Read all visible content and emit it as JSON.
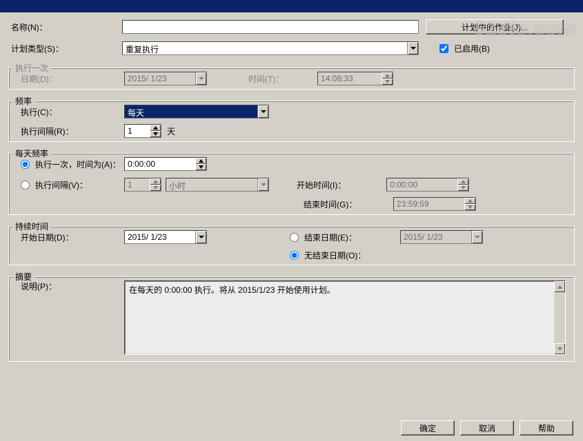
{
  "titlebar": "",
  "watermark": "51cto.com",
  "labels": {
    "name": "名称(N)：",
    "plan_type": "计划类型(S)：",
    "jobs_in_plan_btn": "计划中的作业(J)...",
    "enabled": "已启用(B)",
    "once_group": "执行一次",
    "date": "日期(D)：",
    "time": "时间(T)：",
    "freq_group": "频率",
    "execute": "执行(C)：",
    "exec_interval": "执行间隔(R)：",
    "unit_day": "天",
    "daily_group": "每天频率",
    "once_at": "执行一次，时间为(A)：",
    "interval": "执行间隔(V)：",
    "unit_hour": "小时",
    "start_time": "开始时间(I)：",
    "end_time": "结束时间(G)：",
    "duration_group": "持续时间",
    "start_date": "开始日期(D)：",
    "end_date": "结束日期(E)：",
    "no_end": "无结束日期(O)：",
    "summary_group": "摘要",
    "description": "说明(P)："
  },
  "values": {
    "name": "",
    "plan_type": "重复执行",
    "enabled": true,
    "once_date": "2015/ 1/23",
    "once_time": "14:08:33",
    "execute": "每天",
    "exec_interval": "1",
    "daily_mode": "once",
    "once_at": "0:00:00",
    "interval_n": "1",
    "interval_unit": "小时",
    "start_time": "0:00:00",
    "end_time": "23:59:59",
    "start_date": "2015/ 1/23",
    "end_date": "2015/ 1/23",
    "end_mode": "noend",
    "summary": "在每天的 0:00:00 执行。将从 2015/1/23 开始使用计划。"
  },
  "buttons": {
    "ok": "确定",
    "cancel": "取消",
    "help": "帮助"
  }
}
